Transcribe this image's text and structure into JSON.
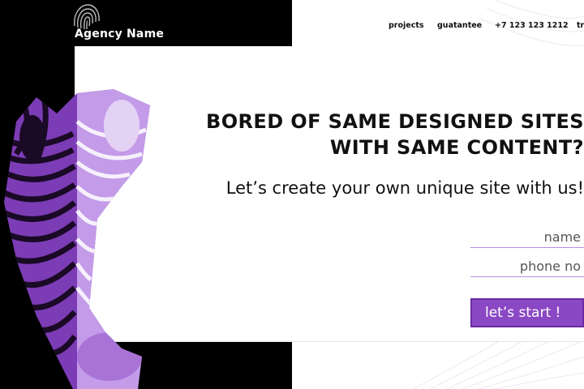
{
  "brand": {
    "name": "Agency Name"
  },
  "nav": {
    "projects": "projects",
    "guarantee": "guatantee",
    "phone": "+7 123 123 1212",
    "extra": "tr"
  },
  "hero": {
    "headline_line1": "BORED OF SAME DESIGNED SITES",
    "headline_line2": "WITH SAME CONTENT?",
    "subheadline": "Let’s create your own unique site with us!"
  },
  "form": {
    "name_placeholder": "name",
    "phone_placeholder": "phone no",
    "submit_label": "let’s start !"
  },
  "colors": {
    "accent": "#8b48c4",
    "accent_light": "#c39be8",
    "accent_border": "#6a2aa6",
    "dark": "#000000"
  },
  "icons": {
    "logo": "fingerprint-icon",
    "hero_image": "zebra-illustration"
  }
}
